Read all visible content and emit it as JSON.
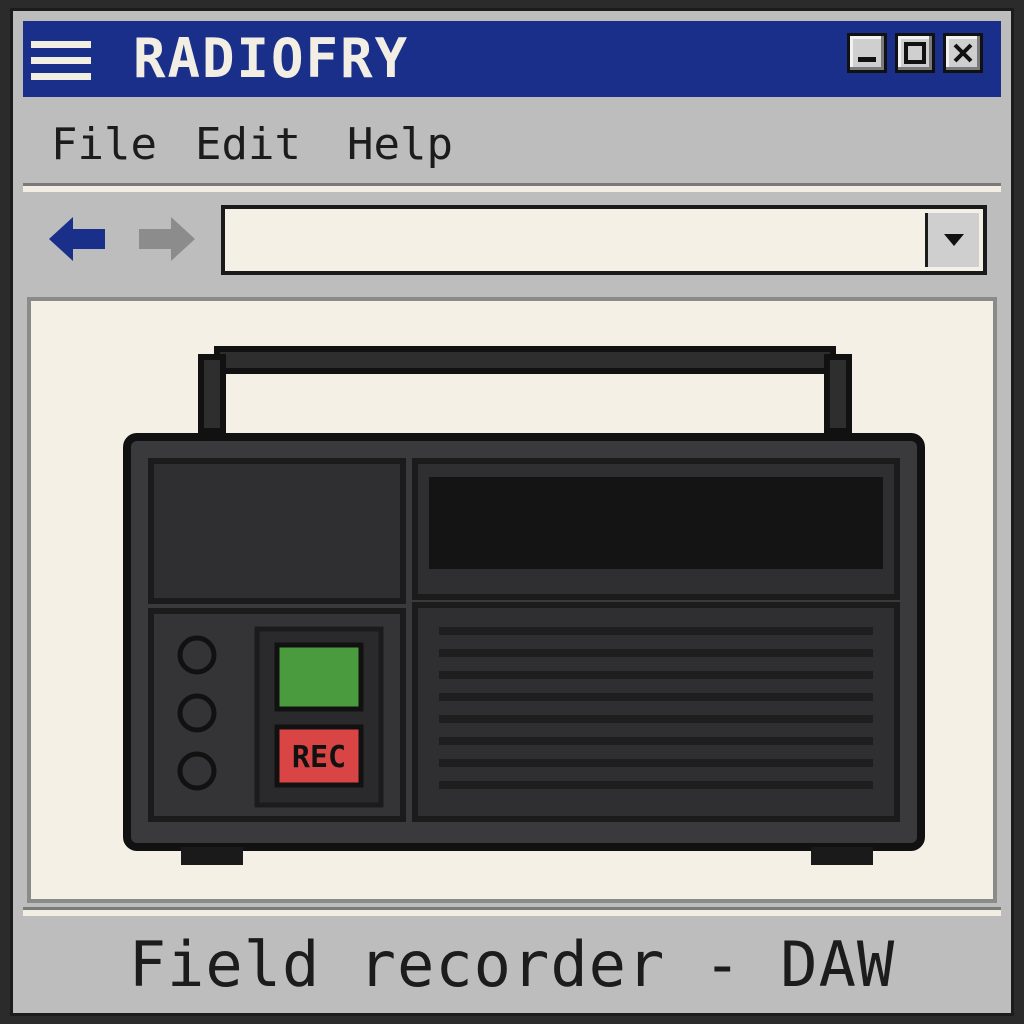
{
  "window": {
    "title": "RADIOFRY",
    "controls": {
      "minimize": "_",
      "maximize": "□",
      "close": "✕"
    }
  },
  "menu": {
    "items": [
      {
        "label": "File"
      },
      {
        "label": "Edit"
      },
      {
        "label": "Help"
      }
    ]
  },
  "navigation": {
    "back_icon": "arrow-left-icon",
    "forward_icon": "arrow-right-icon",
    "address_value": "",
    "dropdown_icon": "triangle-down-icon"
  },
  "device": {
    "icon": "field-recorder-icon",
    "rec_label": "REC",
    "play_color": "#4a9a3e",
    "rec_color": "#d94545"
  },
  "status": {
    "text": "Field recorder - DAW"
  },
  "colors": {
    "titlebar": "#1a2f8a",
    "chrome": "#bdbdbd",
    "content_bg": "#f4f0e6"
  }
}
